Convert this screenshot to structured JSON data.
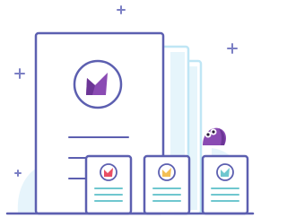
{
  "illustration": {
    "icon": "documents-illustration",
    "colors": {
      "outline": "#5c5fb0",
      "light_blue": "#bfe6f5",
      "pale_blue": "#e6f5fb",
      "purple": "#8a4bb3",
      "red": "#e94e63",
      "yellow": "#f3bf55",
      "teal": "#6fc7cf"
    },
    "cards": [
      {
        "icon": "red-logo-icon"
      },
      {
        "icon": "yellow-logo-icon"
      },
      {
        "icon": "teal-logo-icon"
      }
    ],
    "creature": {
      "icon": "purple-blob-creature-icon"
    }
  }
}
